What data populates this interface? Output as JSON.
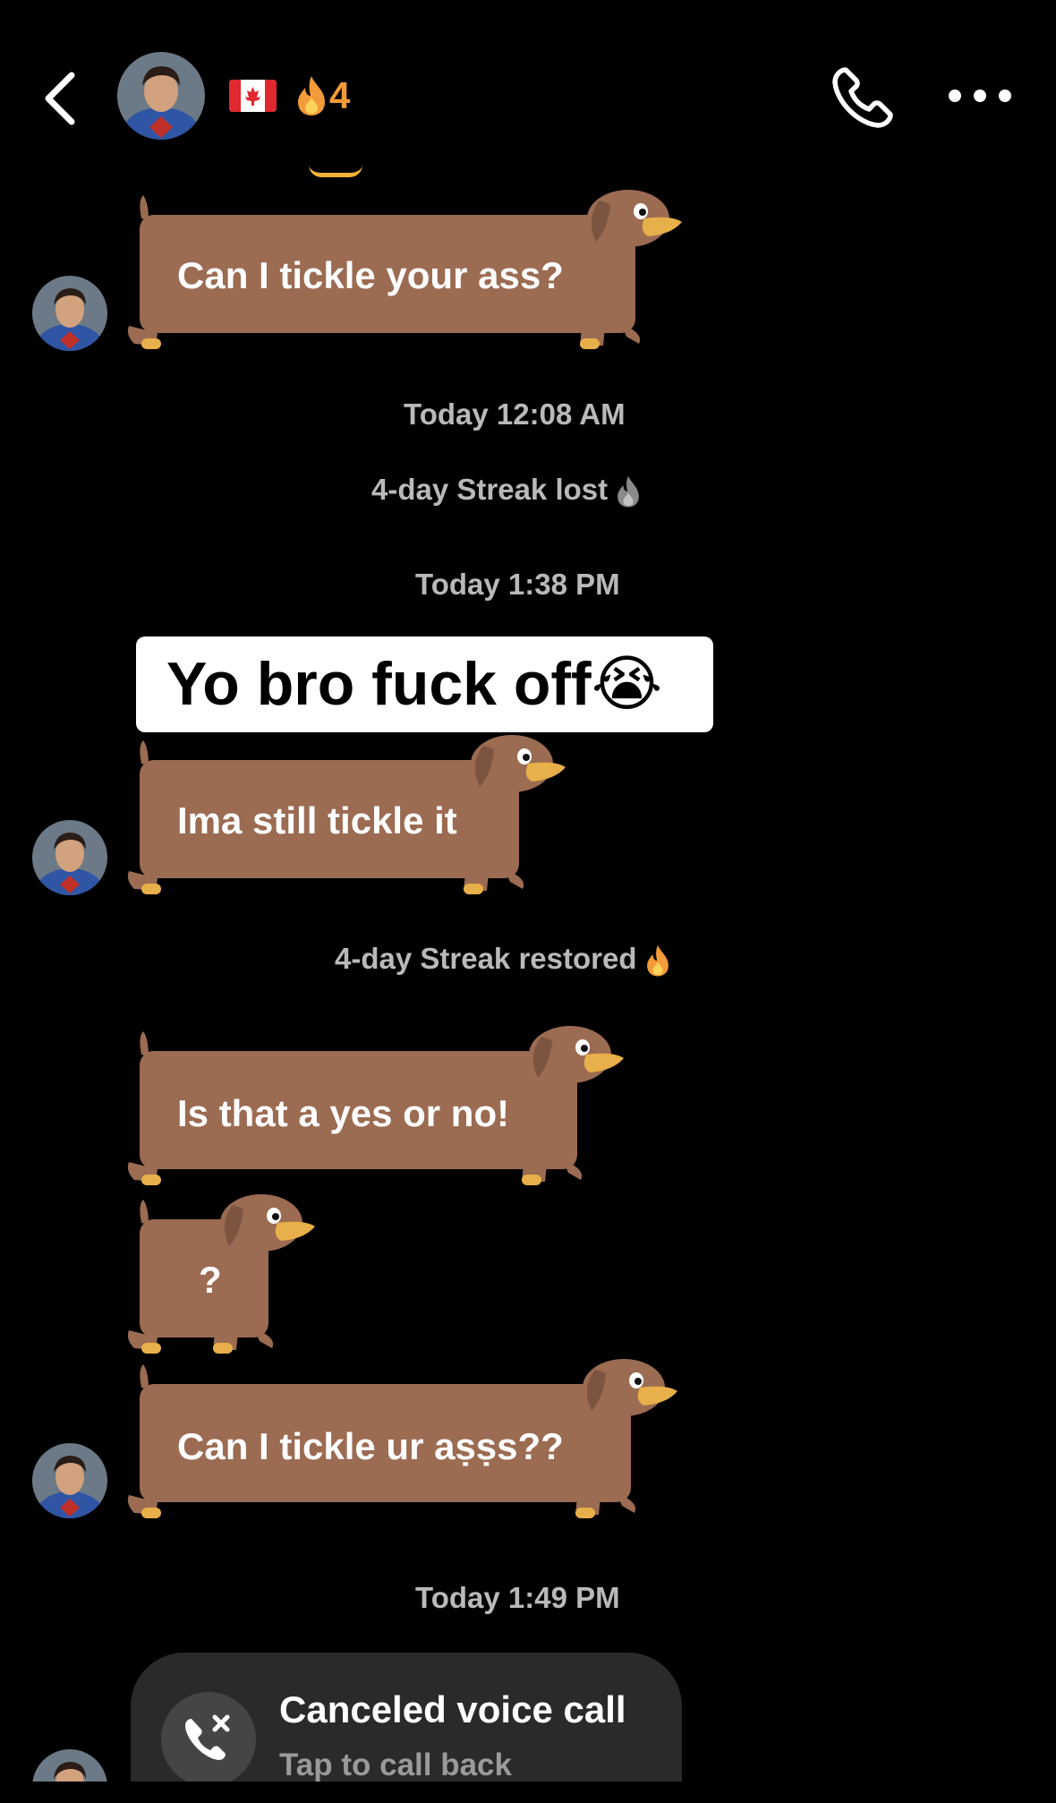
{
  "header": {
    "back_icon": "chevron-left-icon",
    "streak_count": "4",
    "call_icon": "phone-icon",
    "more_icon": "ellipsis-icon"
  },
  "colors": {
    "background": "#000000",
    "bubble_brown": "#9b6b52",
    "streak_orange": "#f39a3a",
    "meta_gray": "#b9b9b9"
  },
  "messages": [
    {
      "text": "Can I tickle your ass?"
    },
    {
      "text": "Ima still tickle it"
    },
    {
      "text": "Is that a yes or no!"
    },
    {
      "text": "?"
    },
    {
      "text": "Can I tickle ur aṣṣs??"
    }
  ],
  "timestamps": [
    "Today 12:08 AM",
    "Today 1:38 PM",
    "Today 1:49 PM"
  ],
  "system": {
    "streak_lost": "4-day Streak lost",
    "streak_restored": "4-day Streak restored"
  },
  "caption": {
    "text": "Yo bro fuck off😭"
  },
  "call": {
    "title": "Canceled voice call",
    "subtitle": "Tap to call back"
  }
}
